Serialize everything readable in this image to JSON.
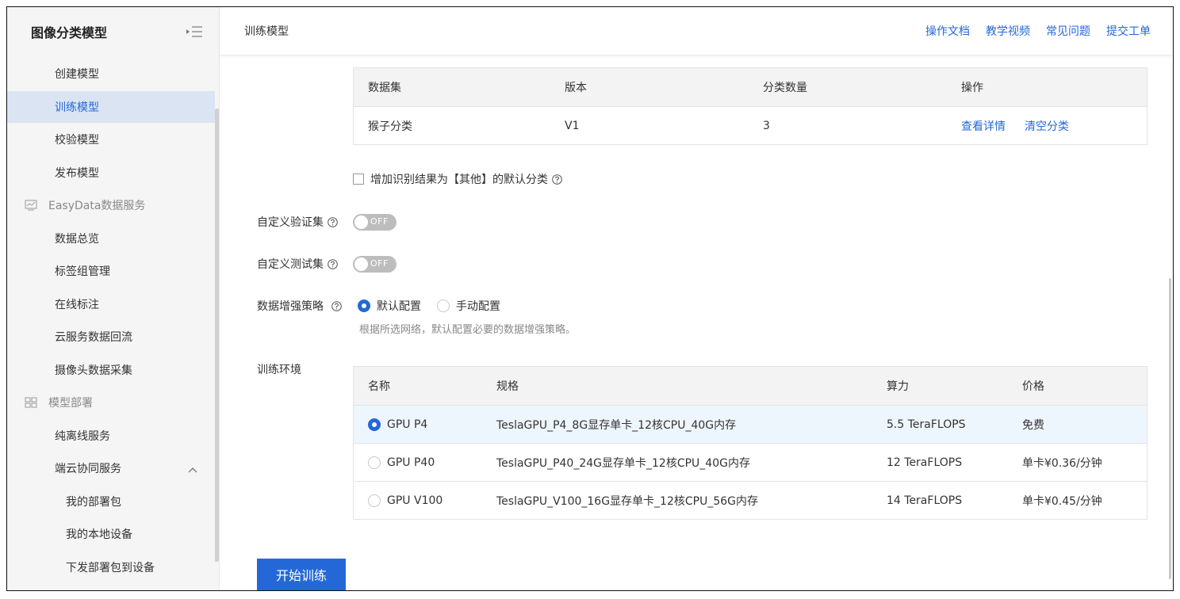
{
  "sidebar": {
    "title": "图像分类模型",
    "items": [
      {
        "label": "创建模型"
      },
      {
        "label": "训练模型"
      },
      {
        "label": "校验模型"
      },
      {
        "label": "发布模型"
      }
    ],
    "group_easydata": {
      "label": "EasyData数据服务",
      "icon": "chart-icon"
    },
    "easydata_items": [
      {
        "label": "数据总览"
      },
      {
        "label": "标签组管理"
      },
      {
        "label": "在线标注"
      },
      {
        "label": "云服务数据回流"
      },
      {
        "label": "摄像头数据采集"
      }
    ],
    "group_deploy": {
      "label": "模型部署",
      "icon": "deploy-icon"
    },
    "deploy_items": [
      {
        "label": "纯离线服务"
      },
      {
        "label": "端云协同服务"
      }
    ],
    "deploy_sub_items": [
      {
        "label": "我的部署包"
      },
      {
        "label": "我的本地设备"
      },
      {
        "label": "下发部署包到设备"
      }
    ]
  },
  "header": {
    "breadcrumb": "训练模型",
    "links": [
      "操作文档",
      "教学视频",
      "常见问题",
      "提交工单"
    ]
  },
  "dataset_table": {
    "headers": [
      "数据集",
      "版本",
      "分类数量",
      "操作"
    ],
    "rows": [
      {
        "dataset": "猴子分类",
        "version": "V1",
        "count": "3",
        "action_view": "查看详情",
        "action_clear": "清空分类"
      }
    ]
  },
  "other_class_checkbox": {
    "label": "增加识别结果为【其他】的默认分类",
    "checked": false
  },
  "custom_validation": {
    "label": "自定义验证集",
    "toggle": "OFF"
  },
  "custom_test": {
    "label": "自定义测试集",
    "toggle": "OFF"
  },
  "augmentation": {
    "label": "数据增强策略",
    "options": [
      "默认配置",
      "手动配置"
    ],
    "selected": "默认配置",
    "hint": "根据所选网络，默认配置必要的数据增强策略。"
  },
  "train_env": {
    "label": "训练环境",
    "headers": [
      "名称",
      "规格",
      "算力",
      "价格"
    ],
    "rows": [
      {
        "name": "GPU P4",
        "spec": "TeslaGPU_P4_8G显存单卡_12核CPU_40G内存",
        "power": "5.5 TeraFLOPS",
        "price": "免费",
        "selected": true
      },
      {
        "name": "GPU P40",
        "spec": "TeslaGPU_P40_24G显存单卡_12核CPU_40G内存",
        "power": "12 TeraFLOPS",
        "price": "单卡¥0.36/分钟",
        "selected": false
      },
      {
        "name": "GPU V100",
        "spec": "TeslaGPU_V100_16G显存单卡_12核CPU_56G内存",
        "power": "14 TeraFLOPS",
        "price": "单卡¥0.45/分钟",
        "selected": false
      }
    ]
  },
  "start_button": "开始训练",
  "colors": {
    "accent": "#2468d8",
    "sidebar_bg": "#f5f5f5",
    "active_bg": "#dbe4f3",
    "selected_row": "#eef6fd"
  }
}
